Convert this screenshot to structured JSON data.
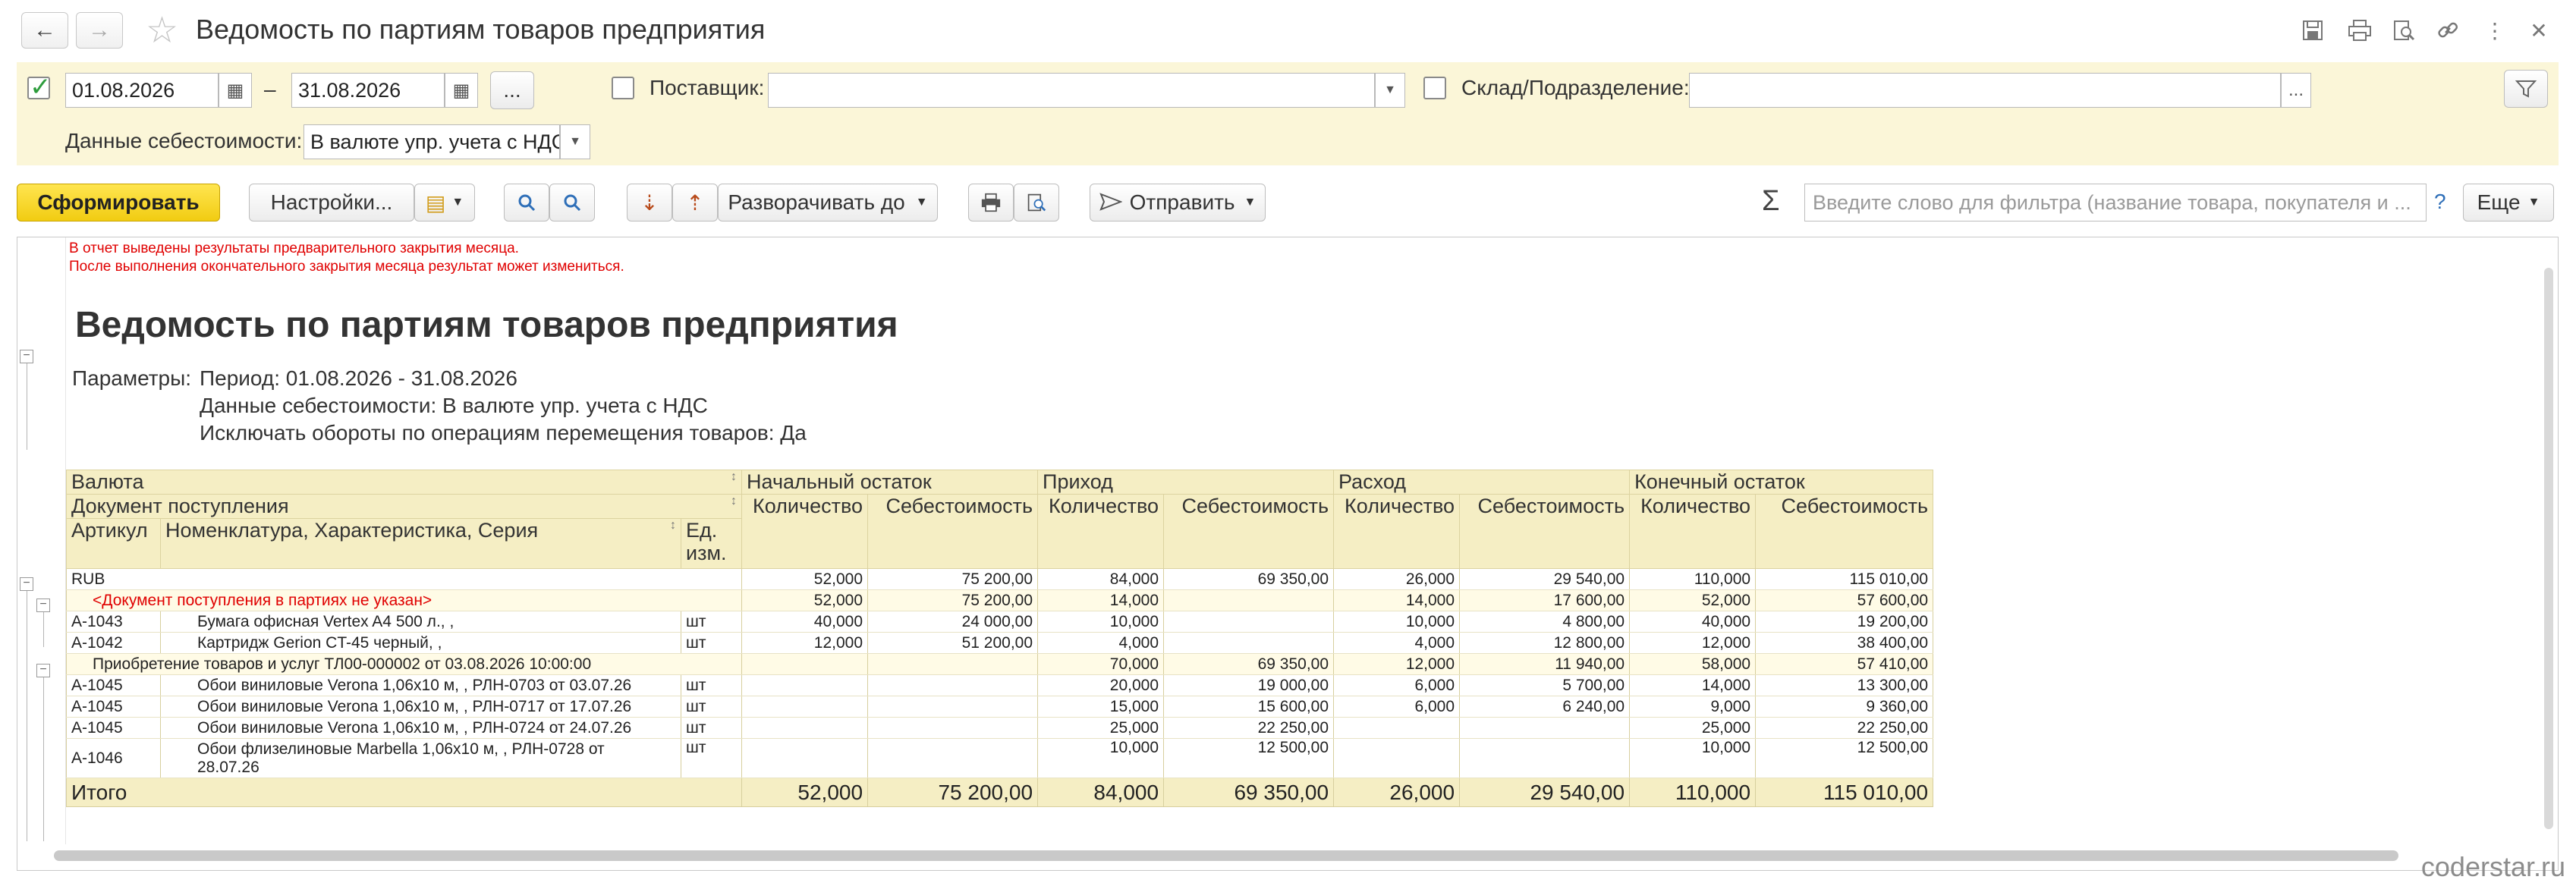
{
  "window": {
    "title": "Ведомость по партиям товаров предприятия",
    "back_icon": "←",
    "forward_icon": "→"
  },
  "params": {
    "period_from": "01.08.2026",
    "period_to": "31.08.2026",
    "dash": "–",
    "more": "...",
    "supplier_label": "Поставщик:",
    "supplier_value": "",
    "warehouse_label": "Склад/Подразделение:",
    "warehouse_value": "",
    "cost_label": "Данные себестоимости:",
    "cost_value": "В валюте упр. учета с НДС"
  },
  "toolbar": {
    "generate": "Сформировать",
    "settings": "Настройки...",
    "expand_to": "Разворачивать до",
    "send": "Отправить",
    "sigma": "Σ",
    "search_placeholder": "Введите слово для фильтра (название товара, покупателя и ...",
    "help": "?",
    "more": "Еще"
  },
  "report": {
    "warning_1": "В отчет выведены результаты предварительного закрытия месяца.",
    "warning_2": "После выполнения окончательного закрытия месяца результат может измениться.",
    "title": "Ведомость по партиям товаров предприятия",
    "params_label": "Параметры:",
    "param_1": "Период: 01.08.2026 - 31.08.2026",
    "param_2": "Данные себестоимости: В валюте упр. учета с НДС",
    "param_3": "Исключать обороты по операциям перемещения товаров: Да",
    "headers": {
      "currency": "Валюта",
      "receipt_doc": "Документ поступления",
      "article": "Артикул",
      "nomenclature": "Номенклатура, Характеристика, Серия",
      "unit": "Ед. изм.",
      "opening": "Начальный остаток",
      "income": "Приход",
      "expense": "Расход",
      "closing": "Конечный остаток",
      "qty": "Количество",
      "cost": "Себестоимость"
    },
    "rows": [
      {
        "type": "grp",
        "label": "RUB",
        "v": [
          "52,000",
          "75 200,00",
          "84,000",
          "69 350,00",
          "26,000",
          "29 540,00",
          "110,000",
          "115 010,00"
        ]
      },
      {
        "type": "doc-red",
        "label": "<Документ поступления в партиях не указан>",
        "v": [
          "52,000",
          "75 200,00",
          "14,000",
          "",
          "14,000",
          "17 600,00",
          "52,000",
          "57 600,00"
        ]
      },
      {
        "type": "item",
        "article": "А-1043",
        "name": "Бумага офисная Vertex A4 500 л., ,",
        "unit": "шт",
        "v": [
          "40,000",
          "24 000,00",
          "10,000",
          "",
          "10,000",
          "4 800,00",
          "40,000",
          "19 200,00"
        ]
      },
      {
        "type": "item",
        "article": "А-1042",
        "name": "Картридж Gerion CT-45 черный, ,",
        "unit": "шт",
        "v": [
          "12,000",
          "51 200,00",
          "4,000",
          "",
          "4,000",
          "12 800,00",
          "12,000",
          "38 400,00"
        ]
      },
      {
        "type": "doc",
        "label": "Приобретение товаров и услуг ТЛ00-000002 от 03.08.2026 10:00:00",
        "v": [
          "",
          "",
          "70,000",
          "69 350,00",
          "12,000",
          "11 940,00",
          "58,000",
          "57 410,00"
        ]
      },
      {
        "type": "item",
        "article": "А-1045",
        "name": "Обои виниловые Verona 1,06х10 м, , РЛН-0703 от 03.07.26",
        "unit": "шт",
        "v": [
          "",
          "",
          "20,000",
          "19 000,00",
          "6,000",
          "5 700,00",
          "14,000",
          "13 300,00"
        ]
      },
      {
        "type": "item",
        "article": "А-1045",
        "name": "Обои виниловые Verona 1,06х10 м, , РЛН-0717 от 17.07.26",
        "unit": "шт",
        "v": [
          "",
          "",
          "15,000",
          "15 600,00",
          "6,000",
          "6 240,00",
          "9,000",
          "9 360,00"
        ]
      },
      {
        "type": "item",
        "article": "А-1045",
        "name": "Обои виниловые Verona 1,06х10 м, , РЛН-0724 от 24.07.26",
        "unit": "шт",
        "v": [
          "",
          "",
          "25,000",
          "22 250,00",
          "",
          "",
          "25,000",
          "22 250,00"
        ]
      },
      {
        "type": "item2",
        "article": "А-1046",
        "name": "Обои флизелиновые Marbella 1,06х10 м, , РЛН-0728 от",
        "name2": "28.07.26",
        "unit": "шт",
        "v": [
          "",
          "",
          "10,000",
          "12 500,00",
          "",
          "",
          "10,000",
          "12 500,00"
        ]
      }
    ],
    "total": {
      "label": "Итого",
      "v": [
        "52,000",
        "75 200,00",
        "84,000",
        "69 350,00",
        "26,000",
        "29 540,00",
        "110,000",
        "115 010,00"
      ]
    }
  },
  "watermark": "coderstar.ru"
}
